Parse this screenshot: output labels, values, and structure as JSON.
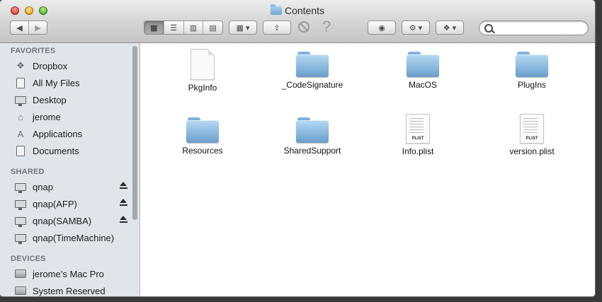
{
  "window": {
    "title": "Contents"
  },
  "toolbar": {
    "back_icon": "chevron-left-icon",
    "forward_icon": "chevron-right-icon",
    "view_modes": [
      "icon-view-icon",
      "list-view-icon",
      "column-view-icon",
      "coverflow-view-icon"
    ],
    "arrange_icon": "arrange-grid-icon",
    "share_icon": "share-icon",
    "quicklook_icon": "eye-icon",
    "action_icon": "gear-icon",
    "dropbox_icon": "dropbox-icon",
    "help_glyph": "?",
    "search": {
      "placeholder": "",
      "value": ""
    }
  },
  "sidebar": {
    "favorites_label": "FAVORITES",
    "favorites": [
      {
        "label": "Dropbox",
        "icon": "dropbox-icon"
      },
      {
        "label": "All My Files",
        "icon": "all-files-icon"
      },
      {
        "label": "Desktop",
        "icon": "desktop-icon"
      },
      {
        "label": "jerome",
        "icon": "home-icon"
      },
      {
        "label": "Applications",
        "icon": "applications-icon"
      },
      {
        "label": "Documents",
        "icon": "documents-icon"
      }
    ],
    "shared_label": "SHARED",
    "shared": [
      {
        "label": "qnap",
        "icon": "monitor-icon",
        "eject": true
      },
      {
        "label": "qnap(AFP)",
        "icon": "monitor-icon",
        "eject": true
      },
      {
        "label": "qnap(SAMBA)",
        "icon": "monitor-icon",
        "eject": true
      },
      {
        "label": "qnap(TimeMachine)",
        "icon": "monitor-icon",
        "eject": false
      }
    ],
    "devices_label": "DEVICES",
    "devices": [
      {
        "label": "jerome’s Mac Pro",
        "icon": "computer-icon"
      },
      {
        "label": "System Reserved",
        "icon": "hard-disk-icon"
      }
    ]
  },
  "files": [
    {
      "name": "PkgInfo",
      "kind": "file"
    },
    {
      "name": "_CodeSignature",
      "kind": "folder"
    },
    {
      "name": "MacOS",
      "kind": "folder"
    },
    {
      "name": "PlugIns",
      "kind": "folder"
    },
    {
      "name": "Resources",
      "kind": "folder"
    },
    {
      "name": "SharedSupport",
      "kind": "folder"
    },
    {
      "name": "Info.plist",
      "kind": "plist",
      "tag": "PLIST"
    },
    {
      "name": "version.plist",
      "kind": "plist",
      "tag": "PLIST"
    }
  ],
  "colors": {
    "sidebar_bg": "#e0e5ec",
    "folder_blue": "#7fb0d8"
  }
}
